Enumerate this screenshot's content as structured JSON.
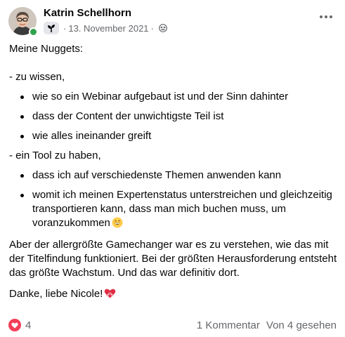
{
  "header": {
    "author": "Katrin Schellhorn",
    "separator": "·",
    "date": "13. November 2021",
    "badge_icon": "sprout-icon",
    "audience_icon": "group-audience-icon",
    "online_color": "#31a24c"
  },
  "post": {
    "intro": "Meine Nuggets:",
    "group1_title": "- zu wissen,",
    "group1_items": [
      "wie so ein Webinar aufgebaut ist und der Sinn dahinter",
      "dass der Content der unwichtigste Teil ist",
      "wie alles ineinander greift"
    ],
    "group2_title": "- ein Tool zu haben,",
    "group2_items": [
      "dass ich auf verschiedenste Themen anwenden kann",
      "womit ich meinen Expertenstatus unterstreichen und gleichzeitig transportieren kann, dass man mich buchen muss, um voranzukommen"
    ],
    "closing_paragraph": "Aber der allergrößte Gamechanger war es zu verstehen, wie das mit der Titelfindung funktioniert. Bei der größten Herausforderung entsteht das größte Wachstum. Und das war definitiv dort.",
    "thanks": "Danke, liebe Nicole!",
    "emoji_grin": "grinning-face-icon",
    "emoji_heart": "heart-with-ribbon-icon"
  },
  "footer": {
    "reaction_count": "4",
    "reaction_icon": "heart-reaction-icon",
    "reaction_color": "#f33e58",
    "comments": "1 Kommentar",
    "seen": "Von 4 gesehen"
  }
}
